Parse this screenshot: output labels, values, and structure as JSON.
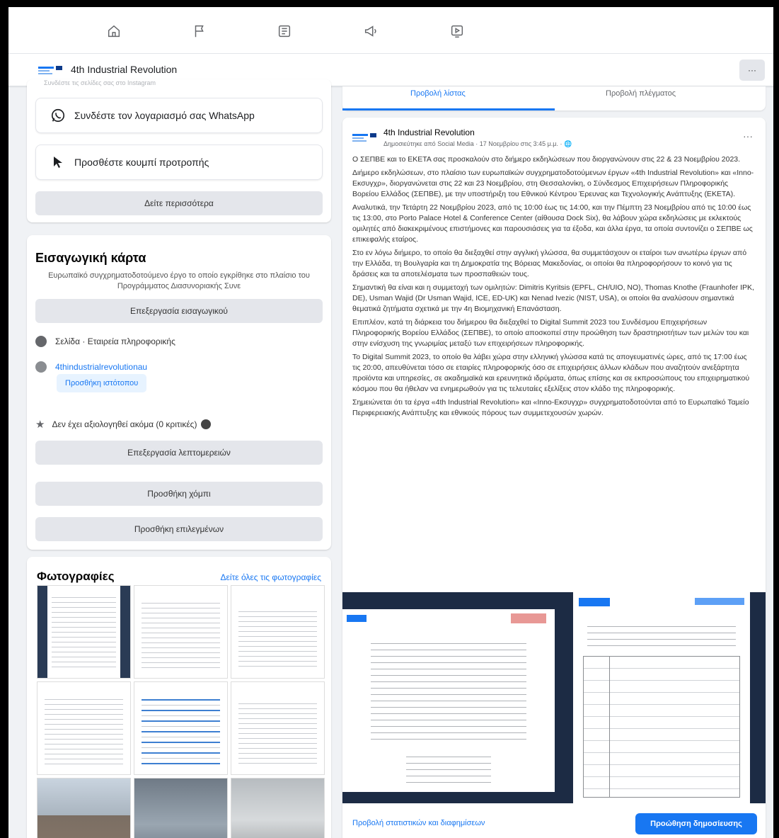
{
  "nav": {
    "icons": [
      "home-icon",
      "flag-icon",
      "pages-icon",
      "megaphone-icon",
      "video-icon"
    ]
  },
  "page_bar": {
    "title": "4th Industrial Revolution",
    "more_label": "···"
  },
  "left": {
    "faded_text": "Συνδέστε τις σελίδες σας στο Instagram",
    "whatsapp_label": "Συνδέστε τον λογαριασμό σας WhatsApp",
    "cta_label": "Προσθέστε κουμπί προτροπής",
    "see_more_label": "Δείτε περισσότερα",
    "intro": {
      "title": "Εισαγωγική κάρτα",
      "description": "Ευρωπαϊκό συγχρηματοδοτούμενο έργο το οποίο εγκρίθηκε στο πλαίσιο του Προγράμματος Διασυνοριακής Συνε",
      "edit_intro_label": "Επεξεργασία εισαγωγικού",
      "category": "Σελίδα · Εταιρεία πληροφορικής",
      "website": "4thindustrialrevolutionau",
      "add_website_label": "Προσθήκη ιστότοπου",
      "rating_text": "Δεν έχει αξιολογηθεί ακόμα (0 κριτικές)",
      "edit_details_label": "Επεξεργασία λεπτομερειών",
      "add_hobbies_label": "Προσθήκη χόμπι",
      "add_featured_label": "Προσθήκη επιλεγμένων"
    },
    "photos": {
      "title": "Φωτογραφίες",
      "see_all_label": "Δείτε όλες τις φωτογραφίες"
    }
  },
  "right": {
    "tabs": [
      "Προβολή λίστας",
      "Προβολή πλέγματος"
    ],
    "post": {
      "page_name": "4th Industrial Revolution",
      "meta": "Δημοσιεύτηκε από Social Media · 17 Νοεμβρίου στις 3:45 μ.μ. · 🌐",
      "paragraphs": [
        "Ο ΣΕΠΒΕ και το ΕΚΕΤΑ σας προσκαλούν στο διήμερο εκδηλώσεων που διοργανώνουν στις 22 & 23 Νοεμβρίου 2023.",
        "Διήμερο εκδηλώσεων, στο πλαίσιο των ευρωπαϊκών συγχρηματοδοτούμενων έργων «4th Industrial Revolution» και «Inno-Εκσυγχρ», διοργανώνεται στις 22 και 23 Νοεμβρίου, στη Θεσσαλονίκη, ο Σύνδεσμος Επιχειρήσεων Πληροφορικής Βορείου Ελλάδος (ΣΕΠΒΕ), με την υποστήριξη του Εθνικού Κέντρου Έρευνας και Τεχνολογικής Ανάπτυξης (ΕΚΕΤΑ).",
        "Αναλυτικά, την Τετάρτη 22 Νοεμβρίου 2023, από τις 10:00 έως τις 14:00, και την Πέμπτη 23 Νοεμβρίου από τις 10:00 έως τις 13:00, στο Porto Palace Hotel & Conference Center (αίθουσα Dock Six), θα λάβουν χώρα εκδηλώσεις με εκλεκτούς ομιλητές από διακεκριμένους επιστήμονες και παρουσιάσεις για τα έξοδα, και άλλα έργα, τα οποία συντονίζει ο ΣΕΠΒΕ ως επικεφαλής εταίρος.",
        "Στο εν λόγω διήμερο, το οποίο θα διεξαχθεί στην αγγλική γλώσσα, θα συμμετάσχουν οι εταίροι των ανωτέρω έργων από την Ελλάδα, τη Βουλγαρία και τη Δημοκρατία της Βόρειας Μακεδονίας, οι οποίοι θα πληροφορήσουν το κοινό για τις δράσεις και τα αποτελέσματα των προσπαθειών τους.",
        "Σημαντική θα είναι και η συμμετοχή των ομιλητών: Dimitris Kyritsis (EPFL, CH/UIO, NO), Thomas Knothe (Fraunhofer IPK, DE), Usman Wajid (Dr Usman Wajid, ICE, ED-UK) και Nenad Ivezic (NIST, USA), οι οποίοι θα αναλύσουν σημαντικά θεματικά ζητήματα σχετικά με την 4η Βιομηχανική Επανάσταση.",
        "Επιπλέον, κατά τη διάρκεια του διήμερου θα διεξαχθεί το Digital Summit 2023 του Συνδέσμου Επιχειρήσεων Πληροφορικής Βορείου Ελλάδος (ΣΕΠΒΕ), το οποίο αποσκοπεί στην προώθηση των δραστηριοτήτων των μελών του και στην ενίσχυση της γνωριμίας μεταξύ των επιχειρήσεων πληροφορικής.",
        "Το Digital Summit 2023, το οποίο θα λάβει χώρα στην ελληνική γλώσσα κατά τις απογευματινές ώρες, από τις 17:00 έως τις 20:00, απευθύνεται τόσο σε εταιρίες πληροφορικής όσο σε επιχειρήσεις άλλων κλάδων που αναζητούν ανεξάρτητα προϊόντα και υπηρεσίες, σε ακαδημαϊκά και ερευνητικά ιδρύματα, όπως επίσης και σε εκπροσώπους του επιχειρηματικού κόσμου που θα ήθελαν να ενημερωθούν για τις τελευταίες εξελίξεις στον κλάδο της πληροφορικής.",
        "Σημειώνεται ότι τα έργα «4th Industrial Revolution» και «Inno-Εκσυγχρ» συγχρηματοδοτούνται από το Ευρωπαϊκό Ταμείο Περιφερειακής Ανάπτυξης και εθνικούς πόρους των συμμετεχουσών χωρών."
      ],
      "stats_link": "Προβολή στατιστικών και διαφημίσεων",
      "boost_label": "Προώθηση δημοσίευσης"
    }
  },
  "colors": {
    "accent": "#1877f2",
    "page_bg": "#f0f2f5",
    "button_gray": "#e4e6eb"
  }
}
